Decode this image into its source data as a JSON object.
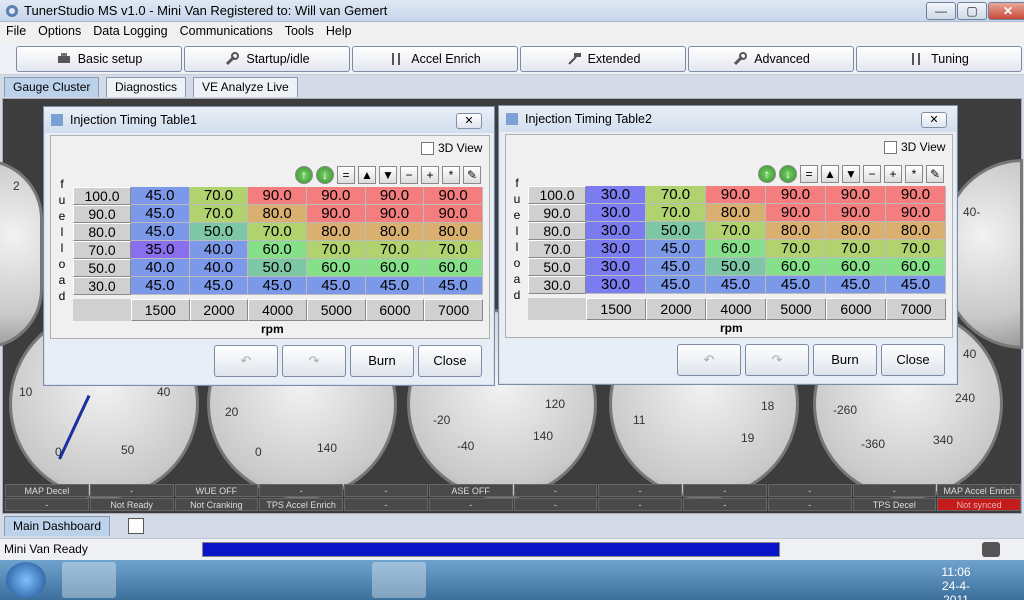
{
  "window": {
    "title": "TunerStudio MS v1.0 - Mini Van Registered to: Will van Gemert",
    "min": "—",
    "max": "▢",
    "close": "✕"
  },
  "menu": [
    "File",
    "Options",
    "Data Logging",
    "Communications",
    "Tools",
    "Help"
  ],
  "toolbar": [
    "Basic setup",
    "Startup/idle",
    "Accel Enrich",
    "Extended",
    "Advanced",
    "Tuning"
  ],
  "tabs": [
    "Gauge Cluster",
    "Diagnostics",
    "VE Analyze Live"
  ],
  "gauges": {
    "labels_left": [
      "2",
      "10",
      "40",
      "50",
      "0"
    ],
    "labels_mid1": [
      "20",
      "0",
      "140"
    ],
    "labels_mid2": [
      "-20",
      "-40",
      "120",
      "140"
    ],
    "labels_mid3": [
      "11",
      "18",
      "19"
    ],
    "labels_right": [
      "-260",
      "-360",
      "240",
      "340",
      "40"
    ],
    "top_right": "40-"
  },
  "status_rows": [
    [
      "MAP Decel",
      "-",
      "WUE OFF",
      "-",
      "-",
      "ASE OFF",
      "-",
      "-",
      "-",
      "-",
      "-",
      "MAP Accel Enrich"
    ],
    [
      "-",
      "Not Ready",
      "Not Cranking",
      "TPS Accel Enrich",
      "-",
      "-",
      "-",
      "-",
      "-",
      "-",
      "TPS Decel",
      "Not synced"
    ]
  ],
  "dialogs": [
    {
      "title": "Injection Timing Table1",
      "view3d": "3D View",
      "yaxis_label": [
        "f",
        "u",
        "e",
        "l",
        "l",
        "o",
        "a",
        "d"
      ],
      "xaxis_label": "rpm",
      "rows": [
        "100.0",
        "90.0",
        "80.0",
        "70.0",
        "50.0",
        "30.0"
      ],
      "cols": [
        "1500",
        "2000",
        "4000",
        "5000",
        "6000",
        "7000"
      ],
      "values": [
        [
          "45.0",
          "70.0",
          "90.0",
          "90.0",
          "90.0",
          "90.0"
        ],
        [
          "45.0",
          "70.0",
          "80.0",
          "90.0",
          "90.0",
          "90.0"
        ],
        [
          "45.0",
          "50.0",
          "70.0",
          "80.0",
          "80.0",
          "80.0"
        ],
        [
          "35.0",
          "40.0",
          "60.0",
          "70.0",
          "70.0",
          "70.0"
        ],
        [
          "40.0",
          "40.0",
          "50.0",
          "60.0",
          "60.0",
          "60.0"
        ],
        [
          "45.0",
          "45.0",
          "45.0",
          "45.0",
          "45.0",
          "45.0"
        ]
      ],
      "burn": "Burn",
      "close": "Close"
    },
    {
      "title": "Injection Timing Table2",
      "view3d": "3D View",
      "yaxis_label": [
        "f",
        "u",
        "e",
        "l",
        "l",
        "o",
        "a",
        "d"
      ],
      "xaxis_label": "rpm",
      "rows": [
        "100.0",
        "90.0",
        "80.0",
        "70.0",
        "50.0",
        "30.0"
      ],
      "cols": [
        "1500",
        "2000",
        "4000",
        "5000",
        "6000",
        "7000"
      ],
      "values": [
        [
          "30.0",
          "70.0",
          "90.0",
          "90.0",
          "90.0",
          "90.0"
        ],
        [
          "30.0",
          "70.0",
          "80.0",
          "90.0",
          "90.0",
          "90.0"
        ],
        [
          "30.0",
          "50.0",
          "70.0",
          "80.0",
          "80.0",
          "80.0"
        ],
        [
          "30.0",
          "45.0",
          "60.0",
          "70.0",
          "70.0",
          "70.0"
        ],
        [
          "30.0",
          "45.0",
          "50.0",
          "60.0",
          "60.0",
          "60.0"
        ],
        [
          "30.0",
          "45.0",
          "45.0",
          "45.0",
          "45.0",
          "45.0"
        ]
      ],
      "burn": "Burn",
      "close": "Close"
    }
  ],
  "tools": [
    "=",
    "▲",
    "▼",
    "−",
    "+",
    "*"
  ],
  "bottom_tab": "Main Dashboard",
  "status": {
    "text": "Mini Van Ready",
    "progress": 1.0
  },
  "clock": {
    "time": "11:06",
    "date": "24-4-2011"
  }
}
